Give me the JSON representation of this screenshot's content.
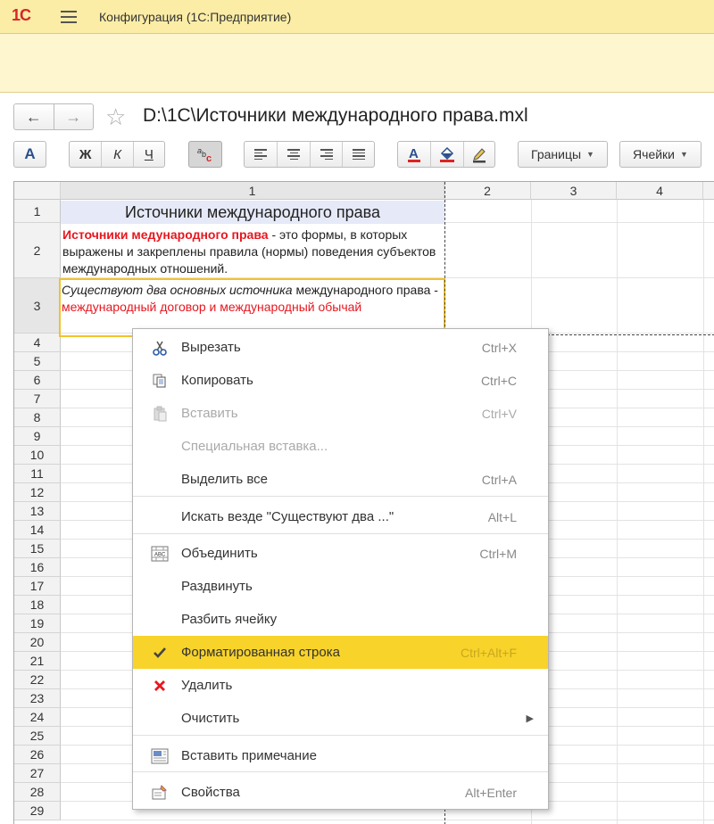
{
  "app": {
    "logo": "1С",
    "title": "Конфигурация  (1С:Предприятие)"
  },
  "document": {
    "title": "D:\\1С\\Источники международного права.mxl"
  },
  "nav": {
    "back": "←",
    "forward": "→",
    "favorite": "☆"
  },
  "toolbar": {
    "font_button": "A",
    "bold": "Ж",
    "italic": "К",
    "underline": "Ч",
    "borders_label": "Границы",
    "cells_label": "Ячейки"
  },
  "grid": {
    "column_headers": [
      "1",
      "2",
      "3",
      "4"
    ],
    "row_headers": [
      "1",
      "2",
      "3",
      "4",
      "5",
      "6",
      "7",
      "8",
      "9",
      "10",
      "11",
      "12",
      "13",
      "14",
      "15",
      "16",
      "17",
      "18",
      "19",
      "20",
      "21",
      "22",
      "23",
      "24",
      "25",
      "26",
      "27",
      "28",
      "29"
    ],
    "cell_title": "Источники международного права",
    "cell_def": {
      "term": "Источники медународного права",
      "text": " - это формы, в которых выражены и закреплены правила (нормы) поведения субъектов международных отношений."
    },
    "cell_src": {
      "italic": "Существуют два основных источника",
      "text": " международного права - ",
      "red": "международный договор и международный обычай"
    }
  },
  "context_menu": {
    "items": [
      {
        "label": "Вырезать",
        "shortcut": "Ctrl+X",
        "icon": "scissors-icon"
      },
      {
        "label": "Копировать",
        "shortcut": "Ctrl+C",
        "icon": "copy-icon"
      },
      {
        "label": "Вставить",
        "shortcut": "Ctrl+V",
        "icon": "paste-icon",
        "disabled": true
      },
      {
        "label": "Специальная вставка...",
        "shortcut": "",
        "disabled": true
      },
      {
        "label": "Выделить все",
        "shortcut": "Ctrl+A"
      },
      {
        "label": "Искать везде \"Существуют два ...\"",
        "shortcut": "Alt+L"
      },
      {
        "label": "Объединить",
        "shortcut": "Ctrl+M",
        "icon": "merge-icon"
      },
      {
        "label": "Раздвинуть",
        "shortcut": ""
      },
      {
        "label": "Разбить ячейку",
        "shortcut": ""
      },
      {
        "label": "Форматированная строка",
        "shortcut": "Ctrl+Alt+F",
        "icon": "checkmark-icon",
        "highlighted": true
      },
      {
        "label": "Удалить",
        "shortcut": "",
        "icon": "delete-icon"
      },
      {
        "label": "Очистить",
        "shortcut": "",
        "submenu": true
      },
      {
        "label": "Вставить примечание",
        "shortcut": "",
        "icon": "note-icon"
      },
      {
        "label": "Свойства",
        "shortcut": "Alt+Enter",
        "icon": "properties-icon"
      }
    ]
  },
  "colors": {
    "accent_yellow": "#f8d32a",
    "title_bar": "#fbeda6",
    "red_text": "#e8161e",
    "logo_red": "#d4262b"
  }
}
